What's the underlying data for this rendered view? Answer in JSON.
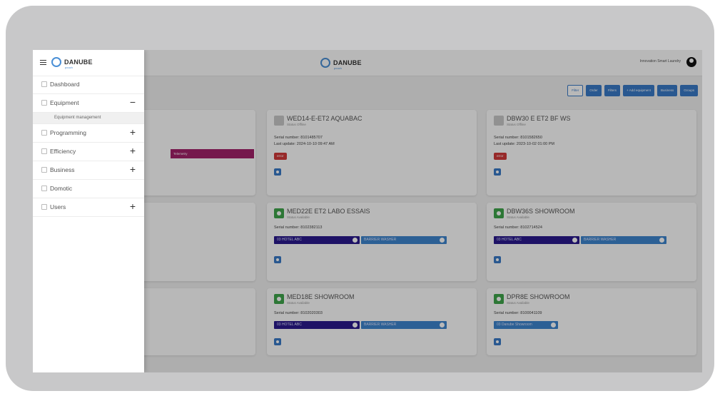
{
  "app": {
    "brand": "DANUBE",
    "brand_sub": "pouch"
  },
  "topbar": {
    "user_name": "Innovation Smart Laundry"
  },
  "toolbar": {
    "buttons": [
      "Filter",
      "Order",
      "Filters",
      "+ Add equipment",
      "Business",
      "Groups"
    ]
  },
  "sidebar": {
    "items": [
      {
        "label": "Dashboard",
        "toggle": ""
      },
      {
        "label": "Equipment",
        "toggle": "−"
      },
      {
        "label": "Programming",
        "toggle": "+"
      },
      {
        "label": "Efficiency",
        "toggle": "+"
      },
      {
        "label": "Business",
        "toggle": "+"
      },
      {
        "label": "Domotic",
        "toggle": ""
      },
      {
        "label": "Users",
        "toggle": "+"
      }
    ],
    "subitem": "Equipment management"
  },
  "partial_card_chip": "Telemetry",
  "cards": [
    {
      "title": "WED14-E-ET2 AQUABAC",
      "status": "Status Offline",
      "serial": "Serial number: 8101485707",
      "last_update": "Last update: 2024-10-10 09:47 AM",
      "error": "error",
      "online": false
    },
    {
      "title": "DBW30 E ET2 BF WS",
      "status": "Status Offline",
      "serial": "Serial number: 8101582650",
      "last_update": "Last update: 2023-10-02 01:00 PM",
      "error": "error",
      "online": false
    },
    {
      "title": "MED22E ET2 LABO ESSAIS",
      "status": "Status Available",
      "serial": "Serial number: 8102382113",
      "chip1": "03 HOTEL ABC",
      "chip2": "BARRIER WASHER",
      "online": true
    },
    {
      "title": "DBW36S SHOWROOM",
      "status": "Status Available",
      "serial": "Serial number: 8102714524",
      "chip1": "03 HOTEL ABC",
      "chip2": "BARRIER WASHER",
      "online": true
    },
    {
      "title": "MED18E SHOWROOM",
      "status": "Status Available",
      "serial": "Serial number: 8102020303",
      "chip1": "03 HOTEL ABC",
      "chip2": "BARRIER WASHER",
      "online": true
    },
    {
      "title": "DPR8E SHOWROOM",
      "status": "Status Available",
      "serial": "Serial number: 8100041109",
      "chip1": "03 Danube Showroom",
      "online": true
    }
  ]
}
